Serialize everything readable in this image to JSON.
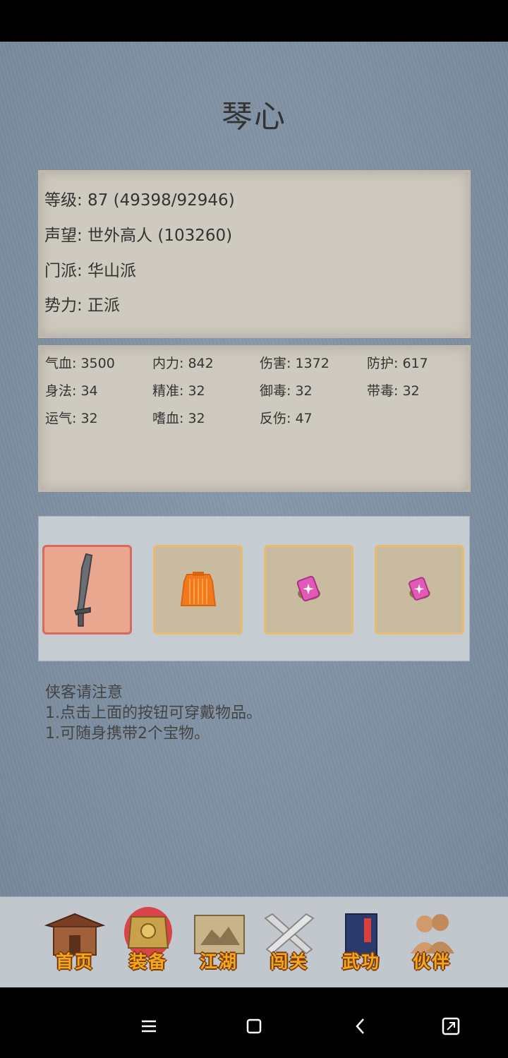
{
  "character": {
    "name": "琴心"
  },
  "info": {
    "level": "等级: 87 (49398/92946)",
    "reputation": "声望: 世外高人 (103260)",
    "sect": "门派: 华山派",
    "faction": "势力:  正派"
  },
  "stats": [
    "气血: 3500",
    "内力: 842",
    "伤害: 1372",
    "防护: 617",
    "身法: 34",
    "精准: 32",
    "御毒: 32",
    "带毒: 32",
    "运气: 32",
    "嗜血: 32",
    "反伤: 47"
  ],
  "equipment": [
    {
      "icon": "sword-icon",
      "selected": true
    },
    {
      "icon": "armor-icon",
      "selected": false
    },
    {
      "icon": "treasure-icon",
      "selected": false
    },
    {
      "icon": "treasure-icon",
      "selected": false
    }
  ],
  "notes": {
    "heading": "侠客请注意",
    "line1": "1.点击上面的按钮可穿戴物品。",
    "line2": "1.可随身携带2个宝物。"
  },
  "nav": {
    "home": "首页",
    "equip": "装备",
    "jianghu": "江湖",
    "stage": "闯关",
    "skills": "武功",
    "partner": "伙伴"
  },
  "colors": {
    "background": "#7f90a3",
    "panel": "#cfcac0",
    "slot_border": "#e7bb70",
    "selected_slot": "#e8a78e",
    "nav_label": "#f2a818"
  }
}
